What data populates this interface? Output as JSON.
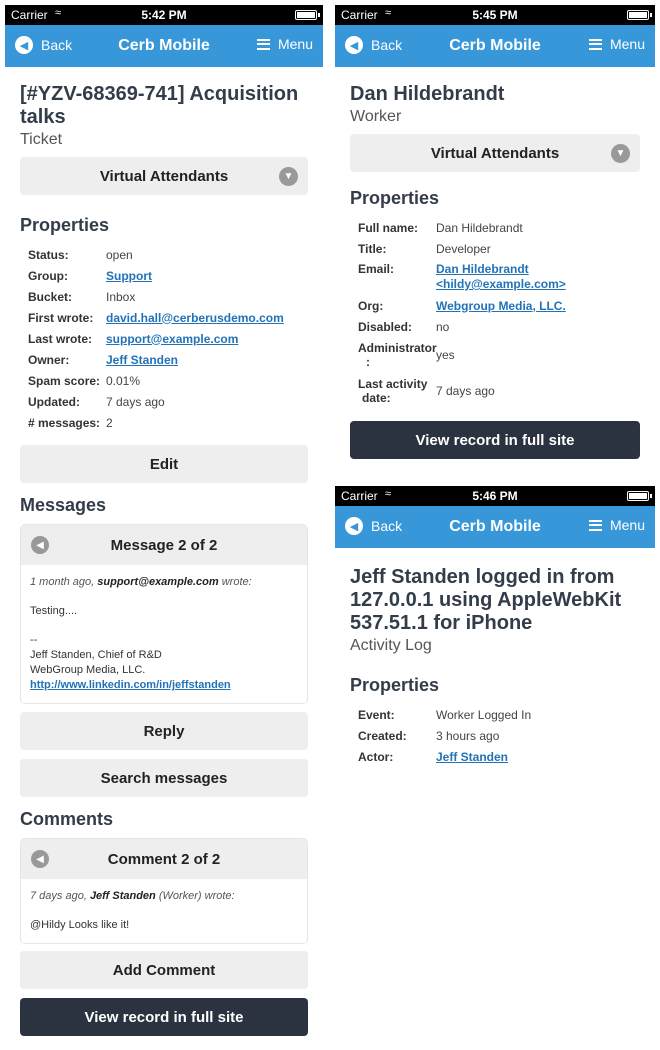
{
  "status_bars": [
    {
      "carrier": "Carrier",
      "time": "5:42 PM"
    },
    {
      "carrier": "Carrier",
      "time": "5:45 PM"
    },
    {
      "carrier": "Carrier",
      "time": "5:46 PM"
    }
  ],
  "nav": {
    "back_label": "Back",
    "title": "Cerb Mobile",
    "menu_label": "Menu"
  },
  "ticket": {
    "title": "[#YZV-68369-741] Acquisition talks",
    "type": "Ticket",
    "virtual_attendants_label": "Virtual Attendants",
    "properties_heading": "Properties",
    "properties": [
      {
        "label": "Status:",
        "value": "open"
      },
      {
        "label": "Group:",
        "value": "Support"
      },
      {
        "label": "Bucket:",
        "value": "Inbox"
      },
      {
        "label": "First wrote:",
        "value": "david.hall@cerberusdemo.com"
      },
      {
        "label": "Last wrote:",
        "value": "support@example.com"
      },
      {
        "label": "Owner:",
        "value": "Jeff Standen"
      },
      {
        "label": "Spam score:",
        "value": "0.01%"
      },
      {
        "label": "Updated:",
        "value": "7 days ago"
      },
      {
        "label": "# messages:",
        "value": "2"
      }
    ],
    "edit_label": "Edit",
    "messages_heading": "Messages",
    "message": {
      "header": "Message 2 of 2",
      "meta_time": "1 month ago,",
      "meta_author": "support@example.com",
      "meta_suffix": "wrote:",
      "body": "Testing....",
      "sig_dash": "--",
      "sig_line1": "Jeff Standen, Chief of R&D",
      "sig_line2": "WebGroup Media, LLC.",
      "sig_link": "http://www.linkedin.com/in/jeffstanden"
    },
    "reply_label": "Reply",
    "search_messages_label": "Search messages",
    "comments_heading": "Comments",
    "comment": {
      "header": "Comment 2 of 2",
      "meta_time": "7 days ago,",
      "meta_author": "Jeff Standen",
      "meta_suffix": "(Worker) wrote:",
      "body": "@Hildy Looks like it!"
    },
    "add_comment_label": "Add Comment",
    "view_full_label": "View record in full site"
  },
  "worker": {
    "title": "Dan Hildebrandt",
    "type": "Worker",
    "virtual_attendants_label": "Virtual Attendants",
    "properties_heading": "Properties",
    "full_name_label": "Full name:",
    "full_name": "Dan Hildebrandt",
    "title_label": "Title:",
    "job_title": "Developer",
    "email_label": "Email:",
    "email_line1": "Dan Hildebrandt",
    "email_line2": "<hildy@example.com>",
    "org_label": "Org:",
    "org": "Webgroup Media, LLC.",
    "disabled_label": "Disabled:",
    "disabled": "no",
    "admin_label_1": "Administrator",
    "admin_label_2": ":",
    "admin": "yes",
    "last_activity_label_1": "Last activity",
    "last_activity_label_2": "date:",
    "last_activity": "7 days ago",
    "view_full_label": "View record in full site"
  },
  "activity": {
    "title": "Jeff Standen logged in from 127.0.0.1 using AppleWebKit 537.51.1 for iPhone",
    "type": "Activity Log",
    "properties_heading": "Properties",
    "properties": [
      {
        "label": "Event:",
        "value": "Worker Logged In"
      },
      {
        "label": "Created:",
        "value": "3 hours ago"
      },
      {
        "label": "Actor:",
        "value": "Jeff Standen"
      }
    ]
  }
}
